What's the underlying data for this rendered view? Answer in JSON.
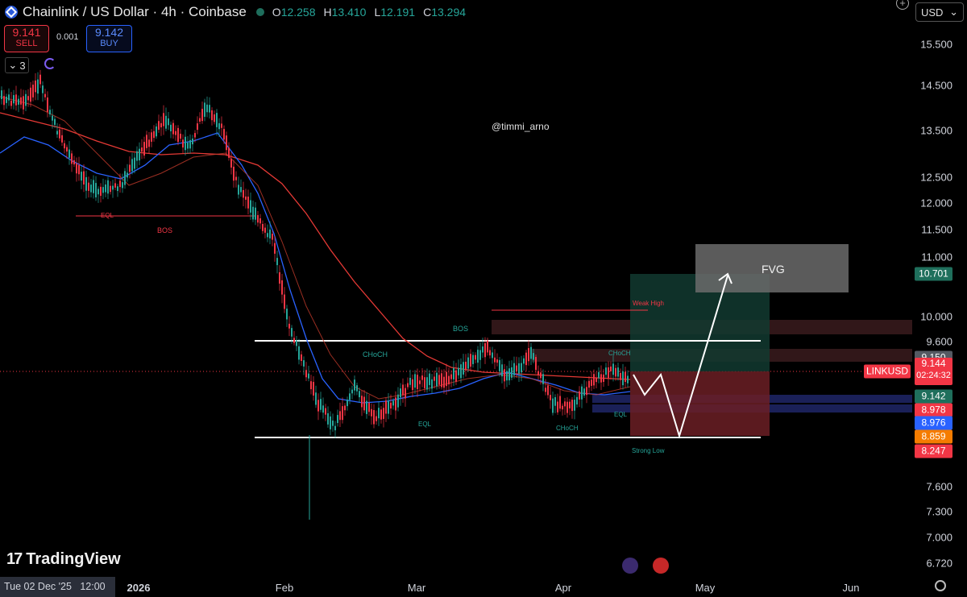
{
  "header": {
    "title": "Chainlink / US Dollar · 4h · Coinbase",
    "ohlc": [
      {
        "k": "O",
        "v": "12.258"
      },
      {
        "k": "H",
        "v": "13.410"
      },
      {
        "k": "L",
        "v": "12.191"
      },
      {
        "k": "C",
        "v": "13.294"
      }
    ]
  },
  "trade": {
    "sell_price": "9.141",
    "sell_label": "SELL",
    "spread": "0.001",
    "buy_price": "9.142",
    "buy_label": "BUY"
  },
  "indicators_count": "3",
  "watermark": "@timmi_arno",
  "currency": "USD",
  "price_axis": [
    "15.500",
    "14.500",
    "13.500",
    "12.500",
    "12.000",
    "11.500",
    "11.000",
    "10.000",
    "9.600",
    "7.600",
    "7.300",
    "7.000",
    "6.720"
  ],
  "price_tags": [
    {
      "value": "10.701",
      "color": "#1f6f5c"
    },
    {
      "value": "9.150",
      "color": "#555a63"
    },
    {
      "value": "9.142",
      "color": "#1f6f5c"
    },
    {
      "value": "8.978",
      "color": "#f23645"
    },
    {
      "value": "8.976",
      "color": "#2962ff"
    },
    {
      "value": "8.859",
      "color": "#f57c00"
    },
    {
      "value": "8.247",
      "color": "#f23645"
    }
  ],
  "last_price": {
    "symbol": "LINKUSD",
    "value": "9.144",
    "countdown": "02:24:32"
  },
  "annotations": {
    "fvg": "FVG",
    "weak_high": "Weak High",
    "strong_low": "Strong Low",
    "bos": "BOS",
    "choch": "CHoCH",
    "eql": "EQL"
  },
  "time_axis": {
    "cursor_date": "Tue 02 Dec '25",
    "cursor_time": "12:00",
    "labels": [
      "2026",
      "Feb",
      "Mar",
      "Apr",
      "May",
      "Jun"
    ]
  },
  "branding": "TradingView",
  "colors": {
    "up": "#26a69a",
    "down": "#f23645",
    "ema_fast": "#2962ff",
    "ema_slow": "#e53935",
    "fvg_box": "#6b6b6b"
  }
}
